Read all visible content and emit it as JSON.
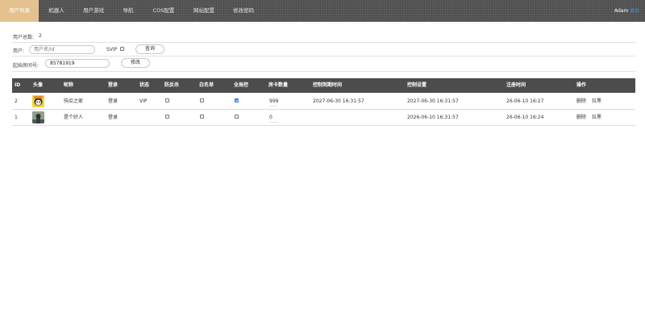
{
  "nav": {
    "tabs": [
      {
        "label": "用户列表",
        "active": true
      },
      {
        "label": "机器人",
        "active": false
      },
      {
        "label": "用户游戏",
        "active": false
      },
      {
        "label": "导航",
        "active": false
      },
      {
        "label": "COS配置",
        "active": false
      },
      {
        "label": "网站配置",
        "active": false
      },
      {
        "label": "修改密码",
        "active": false
      }
    ],
    "user_name": "Adam",
    "user_link": "退出"
  },
  "summary": {
    "total_label": "用户总数:",
    "total_value": "2"
  },
  "search": {
    "user_label": "用户:",
    "user_placeholder": "用户名/id",
    "svip_label": "SVIP",
    "query_button": "查询"
  },
  "room": {
    "label": "起始房间号:",
    "value": "85781919",
    "modify_button": "修改"
  },
  "table": {
    "headers": [
      "ID",
      "头像",
      "昵称",
      "登录",
      "状态",
      "防反杀",
      "白名单",
      "全局控",
      "房卡数量",
      "控制到期时间",
      "控制设置",
      "注册时间",
      "操作"
    ],
    "rows": [
      {
        "id": "2",
        "nickname": "驹瓜之家",
        "login": "登录",
        "status": "VIP",
        "anti_kill": false,
        "whitelist": false,
        "global_ctrl": true,
        "cards": "999",
        "ctrl_expire": "2027-06-30 16:31:57",
        "ctrl_setting": "2027-06-30 16:31:57",
        "reg_time": "26-06-10 16:27",
        "action_delete": "删除",
        "action_ban": "拉黑",
        "avatar": "cartoon-avatar"
      },
      {
        "id": "1",
        "nickname": "是个好人",
        "login": "登录",
        "status": "",
        "anti_kill": false,
        "whitelist": false,
        "global_ctrl": false,
        "cards": "0",
        "ctrl_expire": "",
        "ctrl_setting": "2026-06-10 16:31:57",
        "reg_time": "26-06-10 16:24",
        "action_delete": "删除",
        "action_ban": "拉黑",
        "avatar": "photo-avatar"
      }
    ]
  },
  "colors": {
    "active_tab": "#e3c28f",
    "topbar": "#5a5a5a",
    "table_header": "#4c4c4c",
    "checkbox_checked": "#2c7be5"
  }
}
